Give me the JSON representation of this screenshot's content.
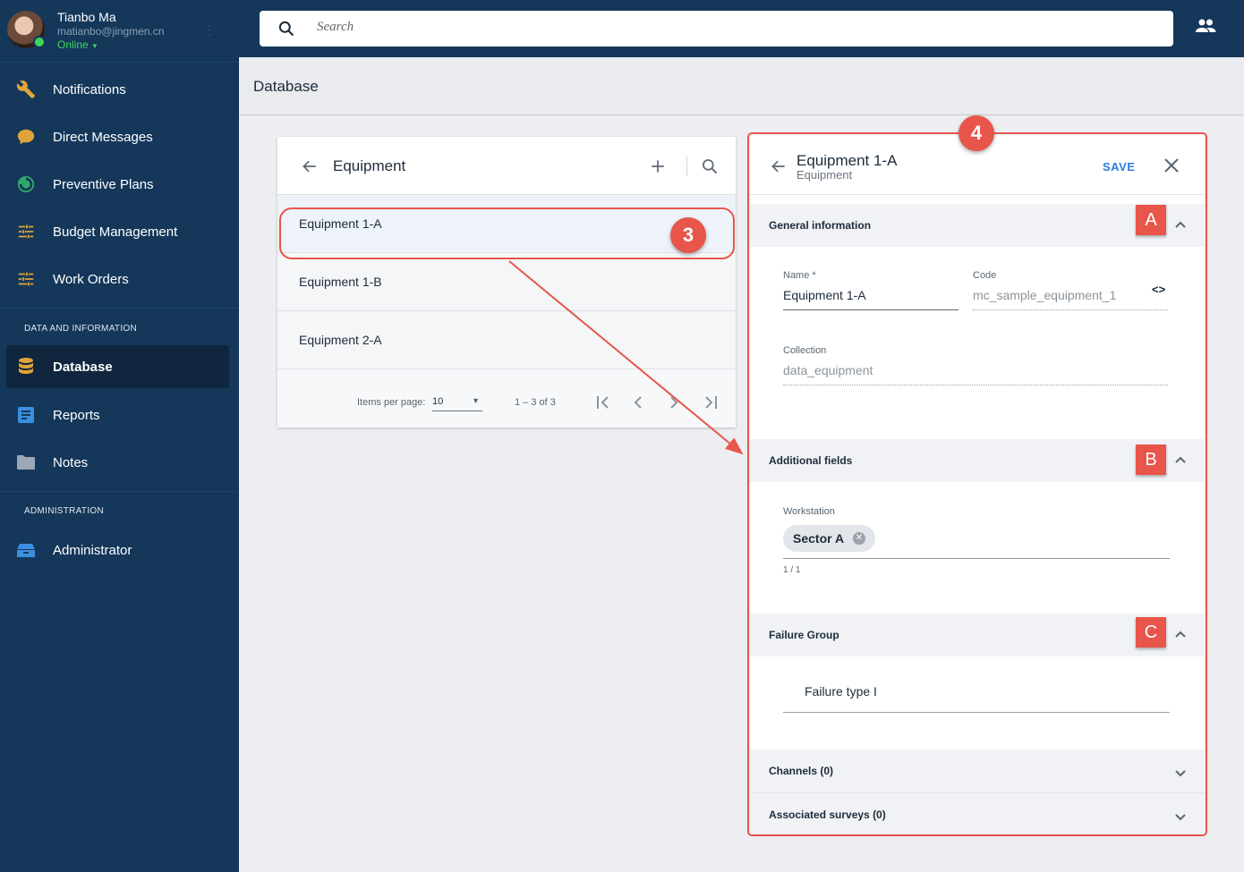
{
  "user": {
    "name": "Tianbo Ma",
    "email": "matianbo@jingmen.cn",
    "status": "Online"
  },
  "nav": {
    "items": [
      {
        "label": "Notifications",
        "icon": "wrench-icon"
      },
      {
        "label": "Direct Messages",
        "icon": "chat-icon"
      },
      {
        "label": "Preventive Plans",
        "icon": "plan-icon"
      },
      {
        "label": "Budget Management",
        "icon": "sliders-icon"
      },
      {
        "label": "Work Orders",
        "icon": "sliders-icon"
      }
    ],
    "section_data": "DATA AND INFORMATION",
    "data_items": [
      {
        "label": "Database",
        "icon": "database-icon",
        "active": true
      },
      {
        "label": "Reports",
        "icon": "report-icon"
      },
      {
        "label": "Notes",
        "icon": "folder-icon"
      }
    ],
    "section_admin": "ADMINISTRATION",
    "admin_items": [
      {
        "label": "Administrator",
        "icon": "admin-icon"
      }
    ]
  },
  "search": {
    "placeholder": "Search"
  },
  "page": {
    "title": "Database"
  },
  "list": {
    "title": "Equipment",
    "rows": [
      "Equipment 1-A",
      "Equipment 1-B",
      "Equipment 2-A"
    ],
    "items_per_page_label": "Items per page:",
    "items_per_page": "10",
    "range": "1 – 3 of 3"
  },
  "detail": {
    "title": "Equipment 1-A",
    "subtitle": "Equipment",
    "save_label": "SAVE",
    "general": {
      "title": "General information",
      "name_label": "Name *",
      "name_value": "Equipment 1-A",
      "code_label": "Code",
      "code_value": "mc_sample_equipment_1",
      "collection_label": "Collection",
      "collection_value": "data_equipment"
    },
    "additional": {
      "title": "Additional fields",
      "workstation_label": "Workstation",
      "chip": "Sector A",
      "count": "1 / 1"
    },
    "failure": {
      "title": "Failure Group",
      "value": "Failure type I"
    },
    "channels": "Channels (0)",
    "surveys": "Associated surveys (0)"
  },
  "annotations": {
    "step3": "3",
    "step4": "4",
    "a": "A",
    "b": "B",
    "c": "C"
  },
  "colors": {
    "sidebar": "#14375a",
    "accent": "#2c7be0",
    "annotation": "#e8554a",
    "online": "#3ed45a"
  }
}
